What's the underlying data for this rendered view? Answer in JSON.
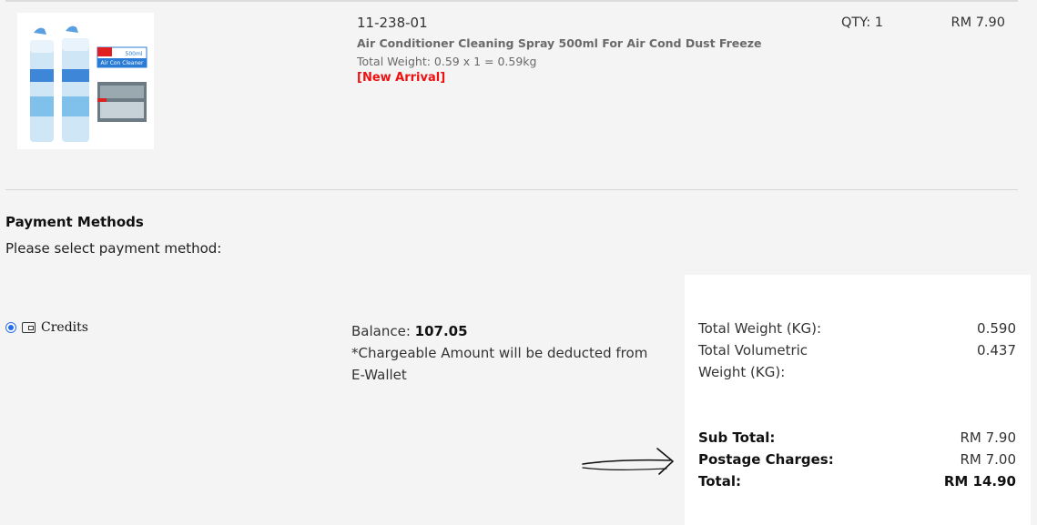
{
  "product": {
    "sku": "11-238-01",
    "name": "Air Conditioner Cleaning Spray 500ml For Air Cond Dust Freeze",
    "weight": "Total Weight: 0.59 x 1 = 0.59kg",
    "badge": "[New Arrival]",
    "qty": "QTY: 1",
    "price": "RM 7.90",
    "image_label": "Air Con Cleaner",
    "image_volume": "500ml"
  },
  "payment": {
    "title": "Payment Methods",
    "subtitle": "Please select payment method:",
    "method_label": "Credits",
    "method_icon": "wallet-icon",
    "balance_label": "Balance:",
    "balance_value": "107.05",
    "note": "*Chargeable Amount will be deducted from E-Wallet"
  },
  "summary": {
    "total_weight_label": "Total Weight (KG):",
    "total_weight_value": "0.590",
    "vol_weight_label": "Total Volumetric Weight (KG):",
    "vol_weight_value": "0.437",
    "subtotal_label": "Sub Total:",
    "subtotal_value": "RM 7.90",
    "postage_label": "Postage Charges:",
    "postage_value": "RM 7.00",
    "total_label": "Total:",
    "total_value": "RM 14.90"
  },
  "colors": {
    "accent_blue": "#1e6ef0",
    "badge_red": "#ee1111"
  }
}
